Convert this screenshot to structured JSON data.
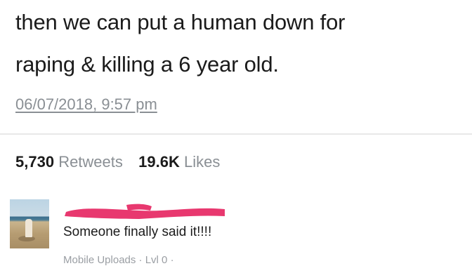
{
  "tweet": {
    "text_line_1": "then we can put a human down for",
    "text_line_2": "raping & killing a 6 year old.",
    "timestamp": "06/07/2018, 9:57 pm"
  },
  "stats": {
    "retweets_count": "5,730",
    "retweets_label": "Retweets",
    "likes_count": "19.6K",
    "likes_label": "Likes"
  },
  "comment": {
    "text": "Someone finally said it!!!!",
    "meta": "Mobile Uploads · Lvl 0 · ",
    "redaction_color": "#e8386f"
  }
}
